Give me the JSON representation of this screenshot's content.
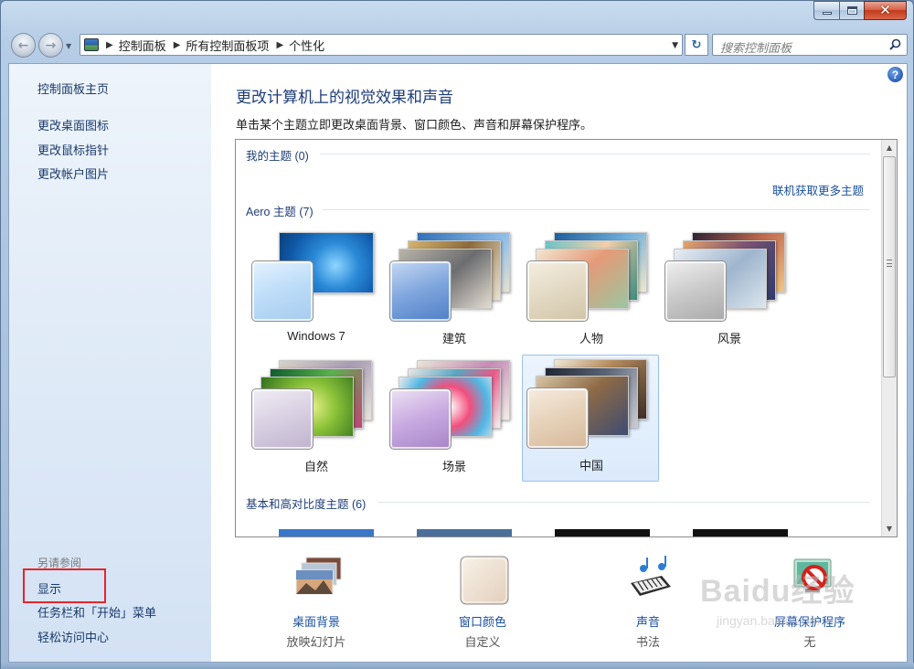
{
  "window": {
    "caption_buttons": {
      "minimize_icon": "minimize-icon",
      "maximize_icon": "maximize-icon",
      "close_glyph": "✕"
    }
  },
  "nav": {
    "back_glyph": "←",
    "forward_glyph": "→",
    "breadcrumbs": [
      "控制面板",
      "所有控制面板项",
      "个性化"
    ],
    "refresh_glyph": "↻",
    "search_placeholder": "搜索控制面板"
  },
  "sidebar": {
    "home_link": "控制面板主页",
    "links": [
      "更改桌面图标",
      "更改鼠标指针",
      "更改帐户图片"
    ],
    "see_also_heading": "另请参阅",
    "see_also_links": [
      "显示",
      "任务栏和「开始」菜单",
      "轻松访问中心"
    ]
  },
  "main": {
    "title": "更改计算机上的视觉效果和声音",
    "subtitle": "单击某个主题立即更改桌面背景、窗口颜色、声音和屏幕保护程序。",
    "help_glyph": "?",
    "my_themes_label": "我的主题 (0)",
    "online_link": "联机获取更多主题",
    "aero_label": "Aero 主题 (7)",
    "basic_label": "基本和高对比度主题 (6)",
    "themes": [
      {
        "name": "Windows 7",
        "selected": false
      },
      {
        "name": "建筑",
        "selected": false
      },
      {
        "name": "人物",
        "selected": false
      },
      {
        "name": "风景",
        "selected": false
      },
      {
        "name": "自然",
        "selected": false
      },
      {
        "name": "场景",
        "selected": false
      },
      {
        "name": "中国",
        "selected": true
      }
    ]
  },
  "quick_settings": [
    {
      "label": "桌面背景",
      "value": "放映幻灯片",
      "icon": "desktop-background-icon"
    },
    {
      "label": "窗口颜色",
      "value": "自定义",
      "icon": "window-color-icon"
    },
    {
      "label": "声音",
      "value": "书法",
      "icon": "sound-icon"
    },
    {
      "label": "屏幕保护程序",
      "value": "无",
      "icon": "screensaver-icon"
    }
  ],
  "watermark": {
    "text": "Baidu经验",
    "url": "jingyan.baidu.com"
  },
  "colors": {
    "link": "#1a4fa0",
    "title": "#1e3d7a",
    "highlight": "#e8242a",
    "selected_tile": "#dbeafc"
  }
}
